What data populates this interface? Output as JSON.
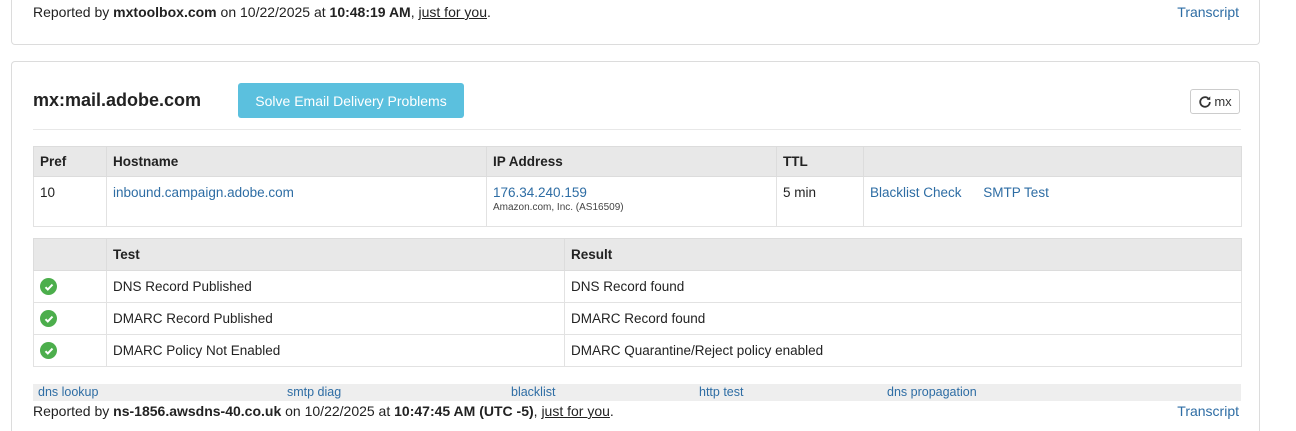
{
  "top_panel": {
    "reported_prefix": "Reported by",
    "reporter": "mxtoolbox.com",
    "on": "on 10/22/2025 at",
    "time": "10:48:19 AM",
    "comma": ",",
    "just_for_you": "just for you",
    "period": ".",
    "transcript": "Transcript"
  },
  "main_panel": {
    "title": "mx:mail.adobe.com",
    "solve_button": "Solve Email Delivery Problems",
    "refresh_button": "mx",
    "mx_table": {
      "headers": [
        "Pref",
        "Hostname",
        "IP Address",
        "TTL",
        ""
      ],
      "rows": [
        {
          "pref": "10",
          "hostname": "inbound.campaign.adobe.com",
          "ip": "176.34.240.159",
          "asn": "Amazon.com, Inc. (AS16509)",
          "ttl": "5 min",
          "blacklist": "Blacklist Check",
          "smtp": "SMTP Test"
        }
      ]
    },
    "test_table": {
      "headers": [
        "",
        "Test",
        "Result"
      ],
      "rows": [
        {
          "test": "DNS Record Published",
          "result": "DNS Record found"
        },
        {
          "test": "DMARC Record Published",
          "result": "DMARC Record found"
        },
        {
          "test": "DMARC Policy Not Enabled",
          "result": "DMARC Quarantine/Reject policy enabled"
        }
      ]
    },
    "tools": [
      "dns lookup",
      "smtp diag",
      "blacklist",
      "http test",
      "dns propagation"
    ],
    "footer": {
      "reported_prefix": "Reported by",
      "reporter": "ns-1856.awsdns-40.co.uk",
      "on": "on 10/22/2025 at",
      "time": "10:47:45 AM (UTC -5)",
      "comma": ",",
      "just_for_you": "just for you",
      "period": ".",
      "transcript": "Transcript"
    }
  },
  "colors": {
    "link": "#2e6da4",
    "button": "#5bc0de",
    "success": "#4cae4c",
    "header_bg": "#e8e8e8"
  },
  "icons": {
    "refresh": "refresh-icon",
    "check": "check-circle-icon"
  }
}
